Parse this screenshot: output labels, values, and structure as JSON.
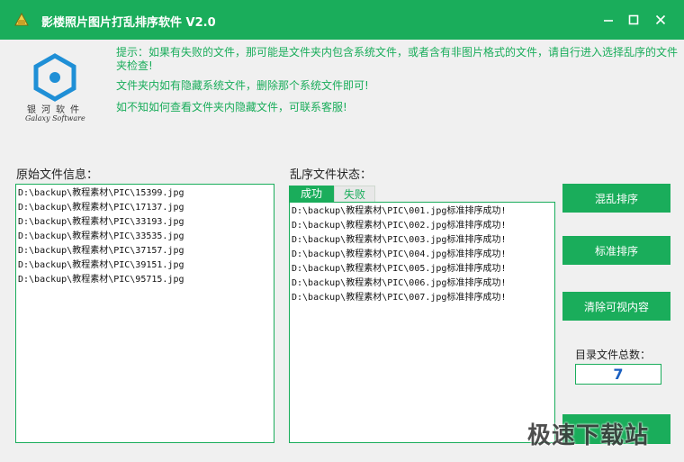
{
  "window": {
    "title": "影楼照片图片打乱排序软件 V2.0",
    "accent_color": "#1aad5b",
    "controls": [
      "minimize-icon",
      "maximize-icon",
      "close-icon"
    ]
  },
  "logo": {
    "name_cn": "银河软件",
    "name_en": "Galaxy Software"
  },
  "tips": [
    "提示：如果有失败的文件，那可能是文件夹内包含系统文件，或者含有非图片格式的文件，请自行进入选择乱序的文件夹检查!",
    "文件夹内如有隐藏系统文件，删除那个系统文件即可!",
    "如不知如何查看文件夹内隐藏文件，可联系客服!"
  ],
  "original": {
    "label": "原始文件信息：",
    "files": [
      "D:\\backup\\教程素材\\PIC\\15399.jpg",
      "D:\\backup\\教程素材\\PIC\\17137.jpg",
      "D:\\backup\\教程素材\\PIC\\33193.jpg",
      "D:\\backup\\教程素材\\PIC\\33535.jpg",
      "D:\\backup\\教程素材\\PIC\\37157.jpg",
      "D:\\backup\\教程素材\\PIC\\39151.jpg",
      "D:\\backup\\教程素材\\PIC\\95715.jpg"
    ]
  },
  "state": {
    "label": "乱序文件状态：",
    "tabs": [
      {
        "label": "成功",
        "active": true
      },
      {
        "label": "失败",
        "active": false
      }
    ],
    "results": [
      "D:\\backup\\教程素材\\PIC\\001.jpg标准排序成功!",
      "D:\\backup\\教程素材\\PIC\\002.jpg标准排序成功!",
      "D:\\backup\\教程素材\\PIC\\003.jpg标准排序成功!",
      "D:\\backup\\教程素材\\PIC\\004.jpg标准排序成功!",
      "D:\\backup\\教程素材\\PIC\\005.jpg标准排序成功!",
      "D:\\backup\\教程素材\\PIC\\006.jpg标准排序成功!",
      "D:\\backup\\教程素材\\PIC\\007.jpg标准排序成功!"
    ]
  },
  "actions": {
    "shuffle": "混乱排序",
    "standard": "标准排序",
    "clear": "清除可视内容"
  },
  "count": {
    "label": "目录文件总数：",
    "value": "7"
  },
  "watermark": "极速下载站"
}
